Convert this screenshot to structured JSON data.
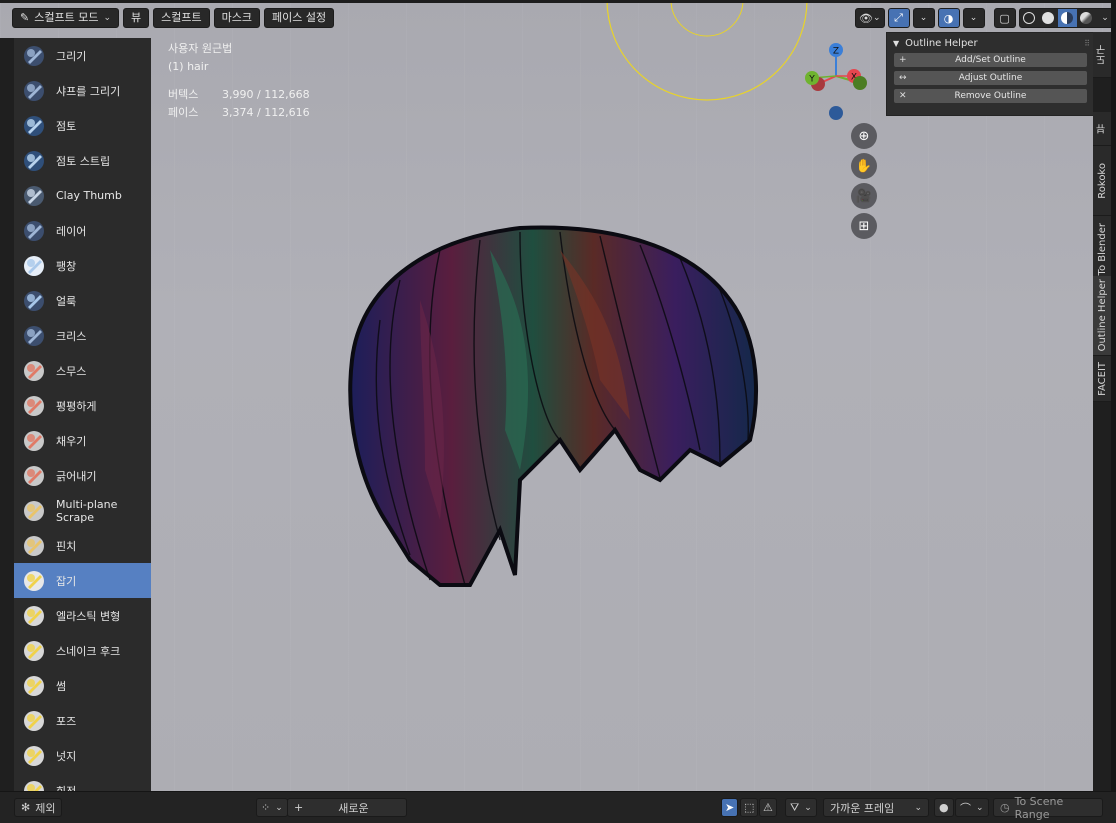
{
  "header": {
    "mode_label": "스컬프트 모드",
    "menus": [
      "뷰",
      "스컬프트",
      "마스크",
      "페이스 설정"
    ]
  },
  "stats": {
    "view_name": "사용자 원근법",
    "object_name": "(1) hair",
    "vertices_label": "버텍스",
    "vertices_value": "3,990 / 112,668",
    "faces_label": "페이스",
    "faces_value": "3,374 / 112,616"
  },
  "tools": [
    {
      "label": "그리기",
      "icon": "draw-brush-icon",
      "active": false
    },
    {
      "label": "샤프를 그리기",
      "icon": "draw-sharp-brush-icon",
      "active": false
    },
    {
      "label": "점토",
      "icon": "clay-brush-icon",
      "active": false
    },
    {
      "label": "점토 스트립",
      "icon": "clay-strips-brush-icon",
      "active": false
    },
    {
      "label": "Clay Thumb",
      "icon": "clay-thumb-brush-icon",
      "active": false
    },
    {
      "label": "레이어",
      "icon": "layer-brush-icon",
      "active": false
    },
    {
      "label": "팽창",
      "icon": "inflate-brush-icon",
      "active": false
    },
    {
      "label": "얼룩",
      "icon": "blob-brush-icon",
      "active": false
    },
    {
      "label": "크리스",
      "icon": "crease-brush-icon",
      "active": false
    },
    {
      "label": "스무스",
      "icon": "smooth-brush-icon",
      "active": false
    },
    {
      "label": "평평하게",
      "icon": "flatten-brush-icon",
      "active": false
    },
    {
      "label": "채우기",
      "icon": "fill-brush-icon",
      "active": false
    },
    {
      "label": "긁어내기",
      "icon": "scrape-brush-icon",
      "active": false
    },
    {
      "label": "Multi-plane Scrape",
      "icon": "multiplane-scrape-brush-icon",
      "active": false
    },
    {
      "label": "핀치",
      "icon": "pinch-brush-icon",
      "active": false
    },
    {
      "label": "잡기",
      "icon": "grab-brush-icon",
      "active": true
    },
    {
      "label": "엘라스틱 변형",
      "icon": "elastic-deform-brush-icon",
      "active": false
    },
    {
      "label": "스네이크 후크",
      "icon": "snake-hook-brush-icon",
      "active": false
    },
    {
      "label": "썸",
      "icon": "thumb-brush-icon",
      "active": false
    },
    {
      "label": "포즈",
      "icon": "pose-brush-icon",
      "active": false
    },
    {
      "label": "넛지",
      "icon": "nudge-brush-icon",
      "active": false
    },
    {
      "label": "회전",
      "icon": "rotate-brush-icon",
      "active": false
    }
  ],
  "gizmo": {
    "x": "X",
    "y": "Y",
    "z": "Z"
  },
  "outline_helper": {
    "title": "Outline Helper",
    "buttons": [
      {
        "icon": "+",
        "label": "Add/Set Outline"
      },
      {
        "icon": "↔",
        "label": "Adjust Outline"
      },
      {
        "icon": "✕",
        "label": "Remove Outline"
      }
    ]
  },
  "side_tabs": [
    "도구",
    "뷰",
    "Rokoko",
    "Daz To Blender",
    "Outline Helper",
    "FACEIT"
  ],
  "footer": {
    "exclude_label": "제외",
    "new_label": "새로운",
    "nearest_frame_label": "가까운 프레임",
    "scene_range_label": "To Scene Range"
  },
  "colors": {
    "accent": "#4772b3",
    "active_tool": "#5680c2",
    "axis_x": "#e5464f",
    "axis_y": "#6fb32f",
    "axis_z": "#3b7fd8"
  }
}
